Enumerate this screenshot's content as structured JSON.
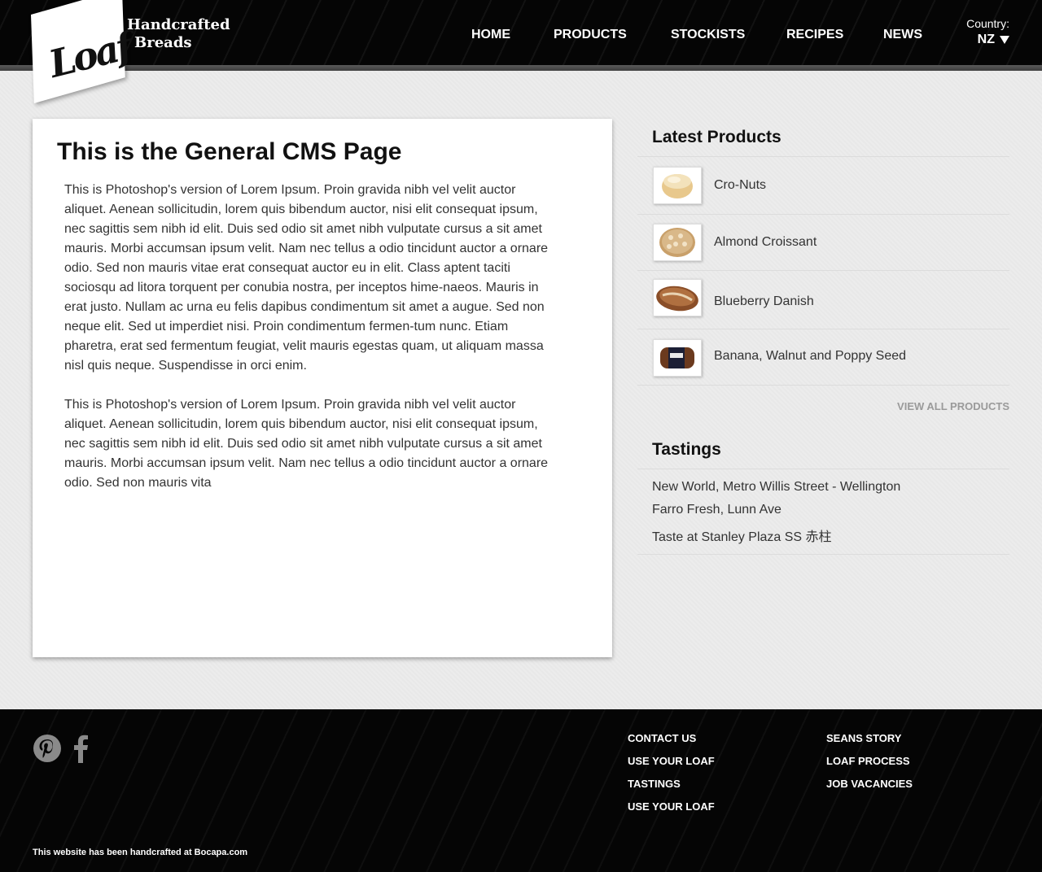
{
  "header": {
    "logo_text": "Loaf",
    "tagline_line1": "Handcrafted",
    "tagline_line2": "Breads",
    "nav": [
      "HOME",
      "PRODUCTS",
      "STOCKISTS",
      "RECIPES",
      "NEWS"
    ],
    "country_label": "Country:",
    "country_value": "NZ"
  },
  "main": {
    "title": "This is the General CMS Page",
    "paragraph1": "This is Photoshop's version  of Lorem Ipsum. Proin gravida nibh vel velit auctor aliquet. Aenean sollicitudin, lorem quis bibendum auctor, nisi elit consequat ipsum, nec sagittis sem nibh id elit. Duis sed odio sit amet nibh vulputate cursus a sit amet mauris. Morbi accumsan ipsum velit. Nam nec tellus a odio tincidunt auctor a ornare odio. Sed non  mauris vitae erat consequat auctor eu in elit. Class aptent taciti sociosqu ad litora torquent per conubia nostra, per inceptos hime-naeos. Mauris in erat justo. Nullam ac urna eu felis dapibus condimentum sit amet a augue. Sed non neque elit. Sed ut imperdiet nisi. Proin condimentum fermen-tum nunc. Etiam pharetra, erat sed fermentum feugiat, velit mauris egestas quam, ut aliquam massa nisl quis neque. Suspendisse in orci enim.",
    "paragraph2": "This is Photoshop's version  of Lorem Ipsum. Proin gravida nibh vel velit auctor aliquet. Aenean sollicitudin, lorem quis bibendum auctor, nisi elit consequat ipsum, nec sagittis sem nibh id elit. Duis sed odio sit amet nibh vulputate cursus a sit amet mauris. Morbi accumsan ipsum velit. Nam nec tellus a odio tincidunt auctor a ornare odio. Sed non  mauris vita"
  },
  "sidebar": {
    "latest_title": "Latest Products",
    "products": [
      {
        "name": "Cro-Nuts"
      },
      {
        "name": "Almond Croissant"
      },
      {
        "name": "Blueberry Danish"
      },
      {
        "name": "Banana, Walnut and Poppy Seed"
      }
    ],
    "view_all": "VIEW ALL PRODUCTS",
    "tastings_title": "Tastings",
    "tastings": [
      "New World, Metro Willis Street - Wellington",
      "Farro Fresh, Lunn Ave",
      "Taste at Stanley Plaza SS 赤柱"
    ]
  },
  "footer": {
    "col1": [
      "CONTACT US",
      "USE YOUR LOAF",
      "TASTINGS",
      "USE YOUR LOAF"
    ],
    "col2": [
      "SEANS STORY",
      "LOAF PROCESS",
      "JOB VACANCIES"
    ],
    "credit": "This website has been handcrafted at Bocapa.com",
    "social": [
      "pinterest-icon",
      "facebook-icon"
    ]
  },
  "colors": {
    "header_bg": "#050505",
    "page_bg": "#ececec",
    "view_all": "#9a9a9a"
  }
}
